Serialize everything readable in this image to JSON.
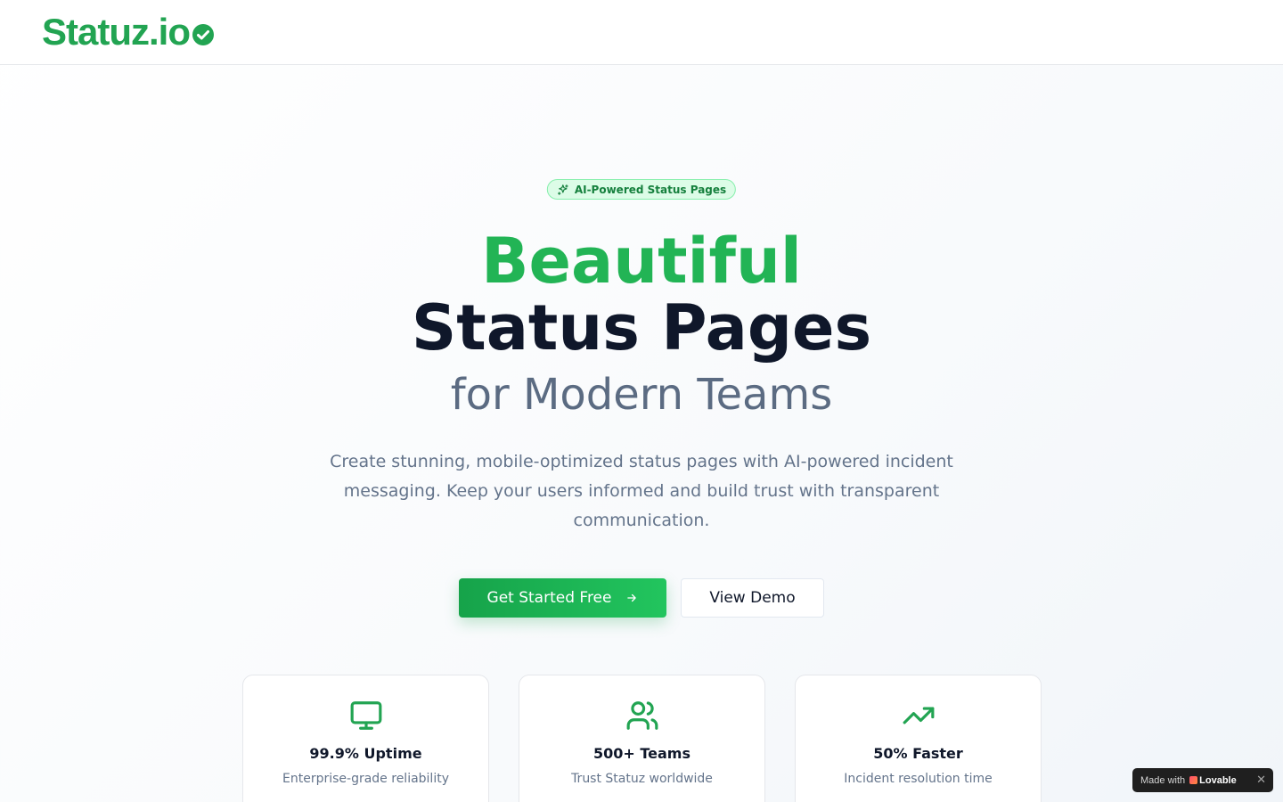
{
  "header": {
    "logo_text": "Statuz.io"
  },
  "hero": {
    "badge": "AI-Powered Status Pages",
    "line1": "Beautiful",
    "line2": "Status Pages",
    "line3": "for Modern Teams",
    "lede": "Create stunning, mobile-optimized status pages with AI-powered incident messaging. Keep your users informed and build trust with transparent communication.",
    "primary_cta": "Get Started Free",
    "secondary_cta": "View Demo"
  },
  "stats": [
    {
      "icon": "monitor-icon",
      "value": "99.9% Uptime",
      "desc": "Enterprise-grade reliability"
    },
    {
      "icon": "users-icon",
      "value": "500+ Teams",
      "desc": "Trust Statuz worldwide"
    },
    {
      "icon": "trending-up-icon",
      "value": "50% Faster",
      "desc": "Incident resolution time"
    }
  ],
  "lovable_badge": {
    "prefix": "Made with",
    "brand": "Lovable"
  },
  "colors": {
    "brand": "#22a452",
    "accent": "#22b455",
    "heading": "#0f172a",
    "muted": "#64748b"
  }
}
